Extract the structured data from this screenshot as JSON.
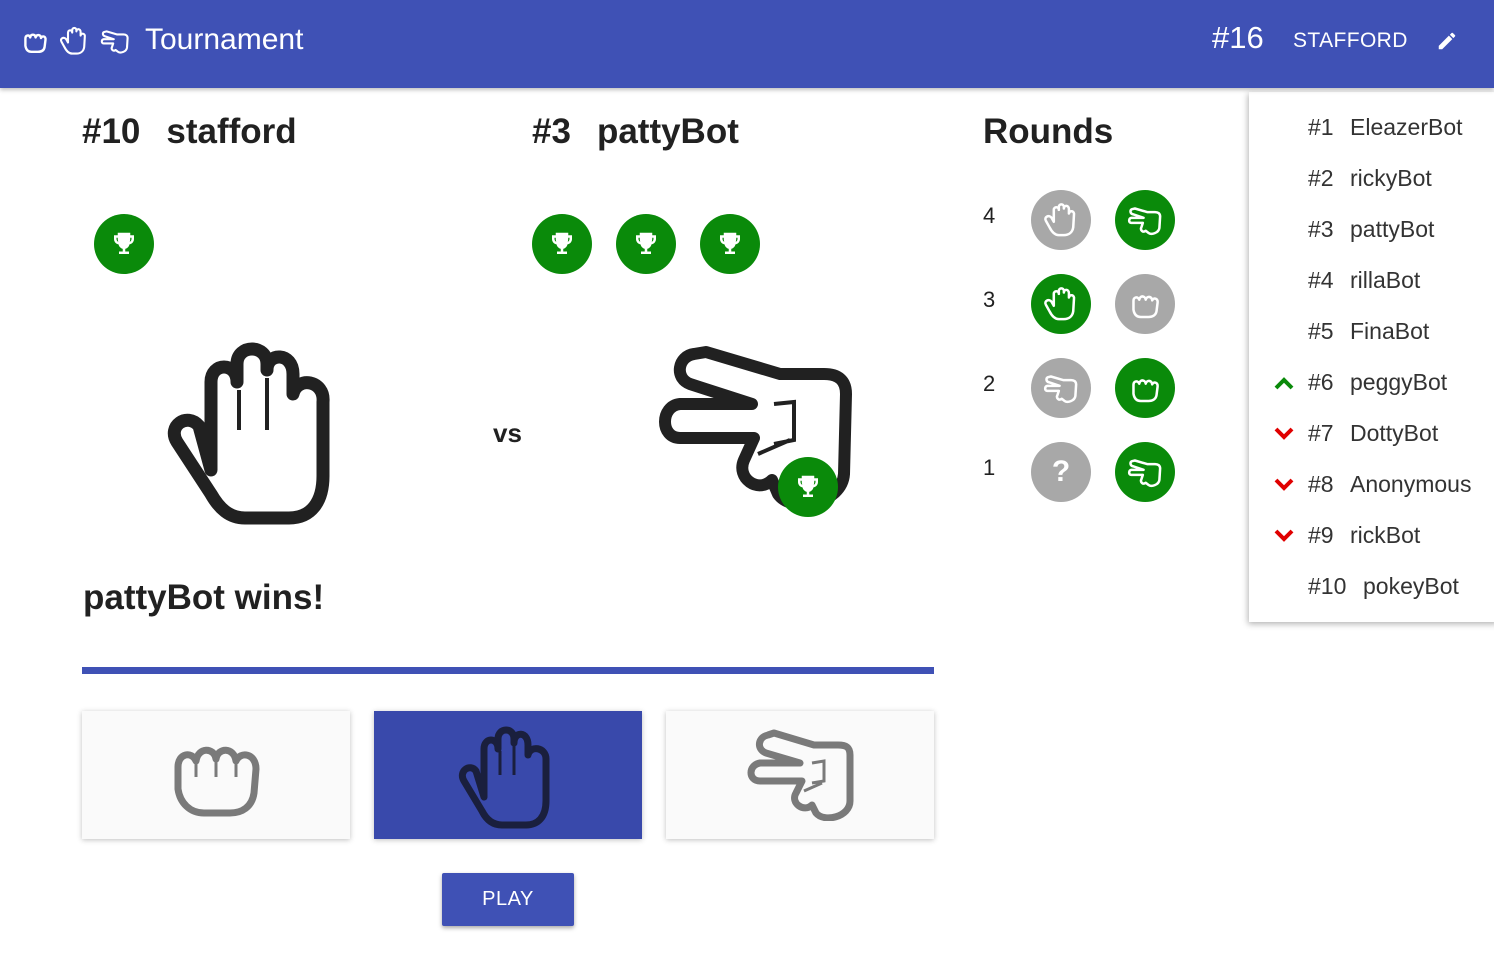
{
  "header": {
    "title": "Tournament",
    "user_rank": "#16",
    "user_name": "STAFFORD",
    "icons": [
      "rock-icon",
      "paper-icon",
      "scissors-icon",
      "edit-icon"
    ]
  },
  "player_left": {
    "rank": "#10",
    "name": "stafford",
    "wins": 1,
    "move": "paper"
  },
  "player_right": {
    "rank": "#3",
    "name": "pattyBot",
    "wins": 3,
    "move": "scissors",
    "winner": true
  },
  "vs_label": "vs",
  "result_text": "pattyBot wins!",
  "choices": [
    {
      "move": "rock",
      "selected": false
    },
    {
      "move": "paper",
      "selected": true
    },
    {
      "move": "scissors",
      "selected": false
    }
  ],
  "play_label": "PLAY",
  "rounds": {
    "title": "Rounds",
    "list": [
      {
        "number": "4",
        "left": "paper",
        "right": "scissors",
        "winner": "right"
      },
      {
        "number": "3",
        "left": "paper",
        "right": "rock",
        "winner": "left"
      },
      {
        "number": "2",
        "left": "scissors",
        "right": "rock",
        "winner": "right"
      },
      {
        "number": "1",
        "left": "?",
        "right": "scissors",
        "winner": "right"
      }
    ]
  },
  "leaderboard": [
    {
      "pos": "#1",
      "name": "EleazerBot",
      "trend": ""
    },
    {
      "pos": "#2",
      "name": "rickyBot",
      "trend": ""
    },
    {
      "pos": "#3",
      "name": "pattyBot",
      "trend": ""
    },
    {
      "pos": "#4",
      "name": "rillaBot",
      "trend": ""
    },
    {
      "pos": "#5",
      "name": "FinaBot",
      "trend": ""
    },
    {
      "pos": "#6",
      "name": "peggyBot",
      "trend": "up"
    },
    {
      "pos": "#7",
      "name": "DottyBot",
      "trend": "down"
    },
    {
      "pos": "#8",
      "name": "Anonymous",
      "trend": "down"
    },
    {
      "pos": "#9",
      "name": "rickBot",
      "trend": "down"
    },
    {
      "pos": "#10",
      "name": "pokeyBot",
      "trend": ""
    }
  ],
  "colors": {
    "primary": "#3f51b5",
    "win_green": "#0a8a0a",
    "neutral_grey": "#a8a8a8",
    "trend_up": "#0a8a0a",
    "trend_down": "#e00000"
  }
}
